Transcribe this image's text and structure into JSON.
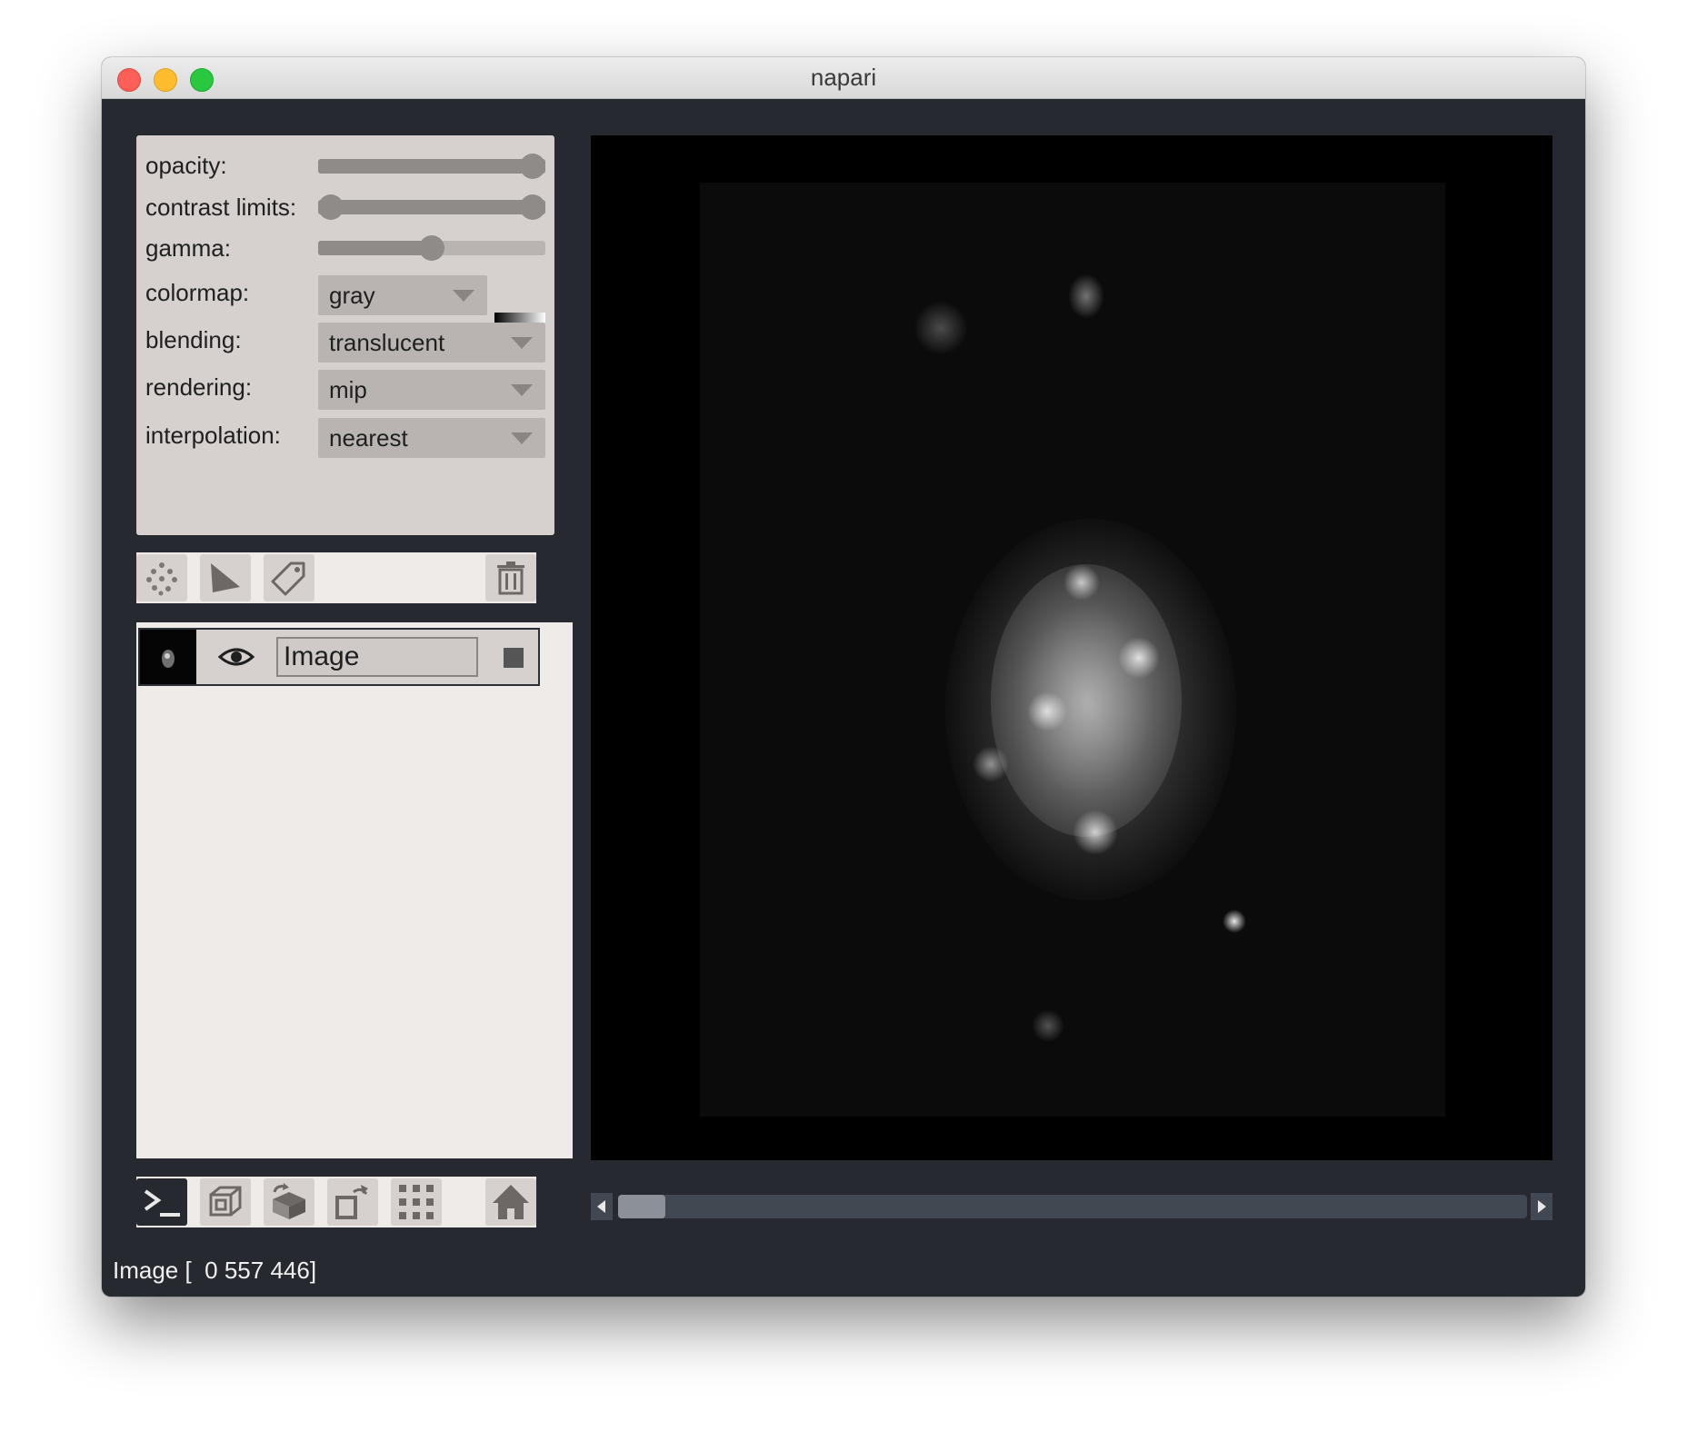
{
  "window": {
    "title": "napari"
  },
  "controls": {
    "opacity": {
      "label": "opacity:",
      "value": 1.0
    },
    "contrast_limits": {
      "label": "contrast limits:",
      "low": 0.0,
      "high": 1.0
    },
    "gamma": {
      "label": "gamma:",
      "value": 0.5
    },
    "colormap": {
      "label": "colormap:",
      "value": "gray"
    },
    "blending": {
      "label": "blending:",
      "value": "translucent"
    },
    "rendering": {
      "label": "rendering:",
      "value": "mip"
    },
    "interpolation": {
      "label": "interpolation:",
      "value": "nearest"
    }
  },
  "layer_buttons": [
    "new-points-icon",
    "new-shapes-icon",
    "new-labels-icon",
    "delete-layer-icon"
  ],
  "layers": [
    {
      "name": "Image",
      "visible": true
    }
  ],
  "console_buttons": [
    "console-icon",
    "ndisplay-icon",
    "roll-dims-icon",
    "transpose-icon",
    "grid-icon",
    "home-icon"
  ],
  "dims_slider": {
    "position_fraction": 0.0
  },
  "status": {
    "text": "Image [  0 557 446]"
  },
  "colors": {
    "background": "#262930",
    "panel": "#d6d0ce",
    "panel_light": "#efebe9"
  }
}
